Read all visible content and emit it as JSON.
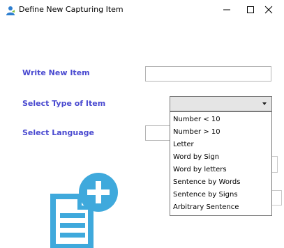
{
  "window": {
    "title": "Define New Capturing Item",
    "app_icon": "user-icon",
    "controls": [
      "minimize-icon",
      "maximize-icon",
      "close-icon"
    ]
  },
  "form": {
    "write_new_item_label": "Write New Item",
    "write_new_item_value": "",
    "select_type_label": "Select Type of Item",
    "select_type_value": "",
    "select_language_label": "Select Language",
    "select_language_value": ""
  },
  "dropdown": {
    "options": [
      "Number < 10",
      "Number > 10",
      "Letter",
      "Word by Sign",
      "Word by letters",
      "Sentence by Words",
      "Sentence by Signs",
      "Arbitrary Sentence"
    ]
  },
  "decor": {
    "main_icon": "document-add-icon",
    "icon_color": "#3fa9dc",
    "label_color": "#4a4ad0"
  }
}
